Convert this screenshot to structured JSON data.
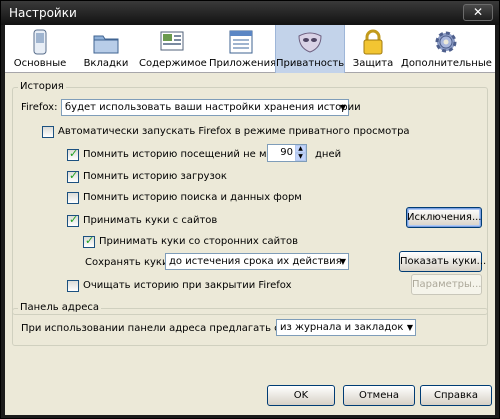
{
  "window": {
    "title": "Настройки",
    "close": "✕"
  },
  "tabs": [
    "Основные",
    "Вкладки",
    "Содержимое",
    "Приложения",
    "Приватность",
    "Защита",
    "Дополнительные"
  ],
  "history": {
    "legend": "История",
    "firefox_label": "Firefox:",
    "firefox_select": "будет использовать ваши настройки хранения истории",
    "auto_private": "Автоматически запускать Firefox в режиме приватного просмотра",
    "remember_visits_prefix": "Помнить историю посещений не менее",
    "days_value": "90",
    "days_suffix": "дней",
    "remember_downloads": "Помнить историю загрузок",
    "remember_search": "Помнить историю поиска и данных форм",
    "accept_cookies": "Принимать куки с сайтов",
    "exceptions_btn": "Исключения...",
    "third_party": "Принимать куки со сторонних сайтов",
    "keep_label": "Сохранять куки:",
    "keep_select": "до истечения срока их действия",
    "show_cookies_btn": "Показать куки...",
    "clear_on_close": "Очищать историю при закрытии Firefox",
    "settings_btn": "Параметры..."
  },
  "addressbar": {
    "legend": "Панель адреса",
    "suggest_label": "При использовании панели адреса предлагать ссылки:",
    "suggest_select": "из журнала и закладок"
  },
  "footer": {
    "ok": "OK",
    "cancel": "Отмена",
    "help": "Справка"
  }
}
